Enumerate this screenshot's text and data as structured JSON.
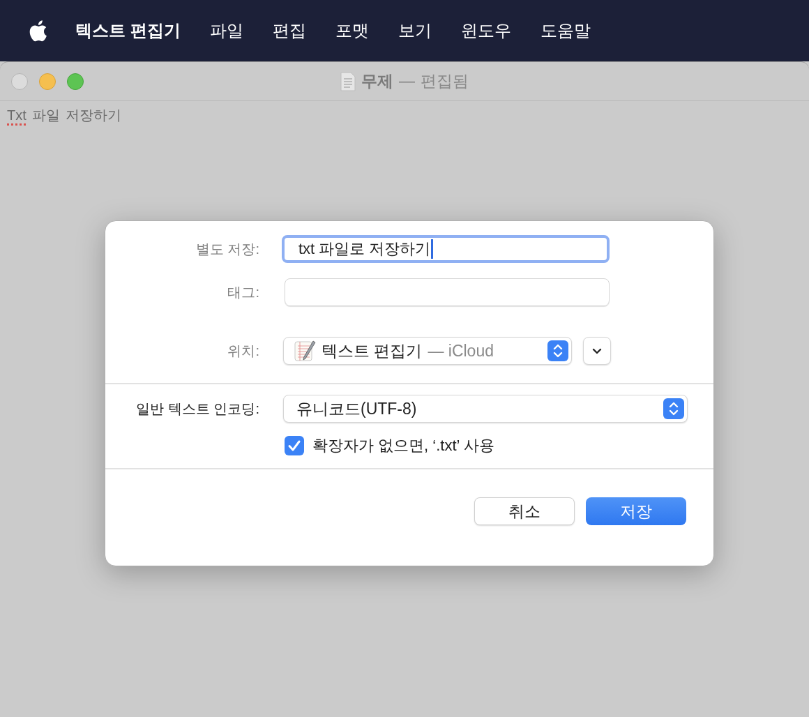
{
  "menu_bar": {
    "app_name": "텍스트 편집기",
    "items": [
      "파일",
      "편집",
      "포맷",
      "보기",
      "윈도우",
      "도움말"
    ]
  },
  "window": {
    "title": "무제",
    "separator": "—",
    "status": "편집됨"
  },
  "document_words": [
    {
      "text": "Txt",
      "misspelled": true
    },
    {
      "text": "파일",
      "misspelled": false
    },
    {
      "text": "저장하기",
      "misspelled": false
    }
  ],
  "dialog": {
    "save_as": {
      "label": "별도 저장:",
      "value": "txt 파일로 저장하기",
      "focused": true
    },
    "tags": {
      "label": "태그:"
    },
    "location": {
      "label": "위치:",
      "value": "텍스트 편집기",
      "detail": "— iCloud"
    },
    "encoding": {
      "label": "일반 텍스트 인코딩:",
      "value": "유니코드(UTF-8)"
    },
    "extension_option": {
      "label": "확장자가 없으면, ‘.txt’ 사용",
      "checked": true
    },
    "buttons": [
      {
        "label": "취소",
        "kind": "secondary"
      },
      {
        "label": "저장",
        "kind": "primary"
      }
    ]
  }
}
